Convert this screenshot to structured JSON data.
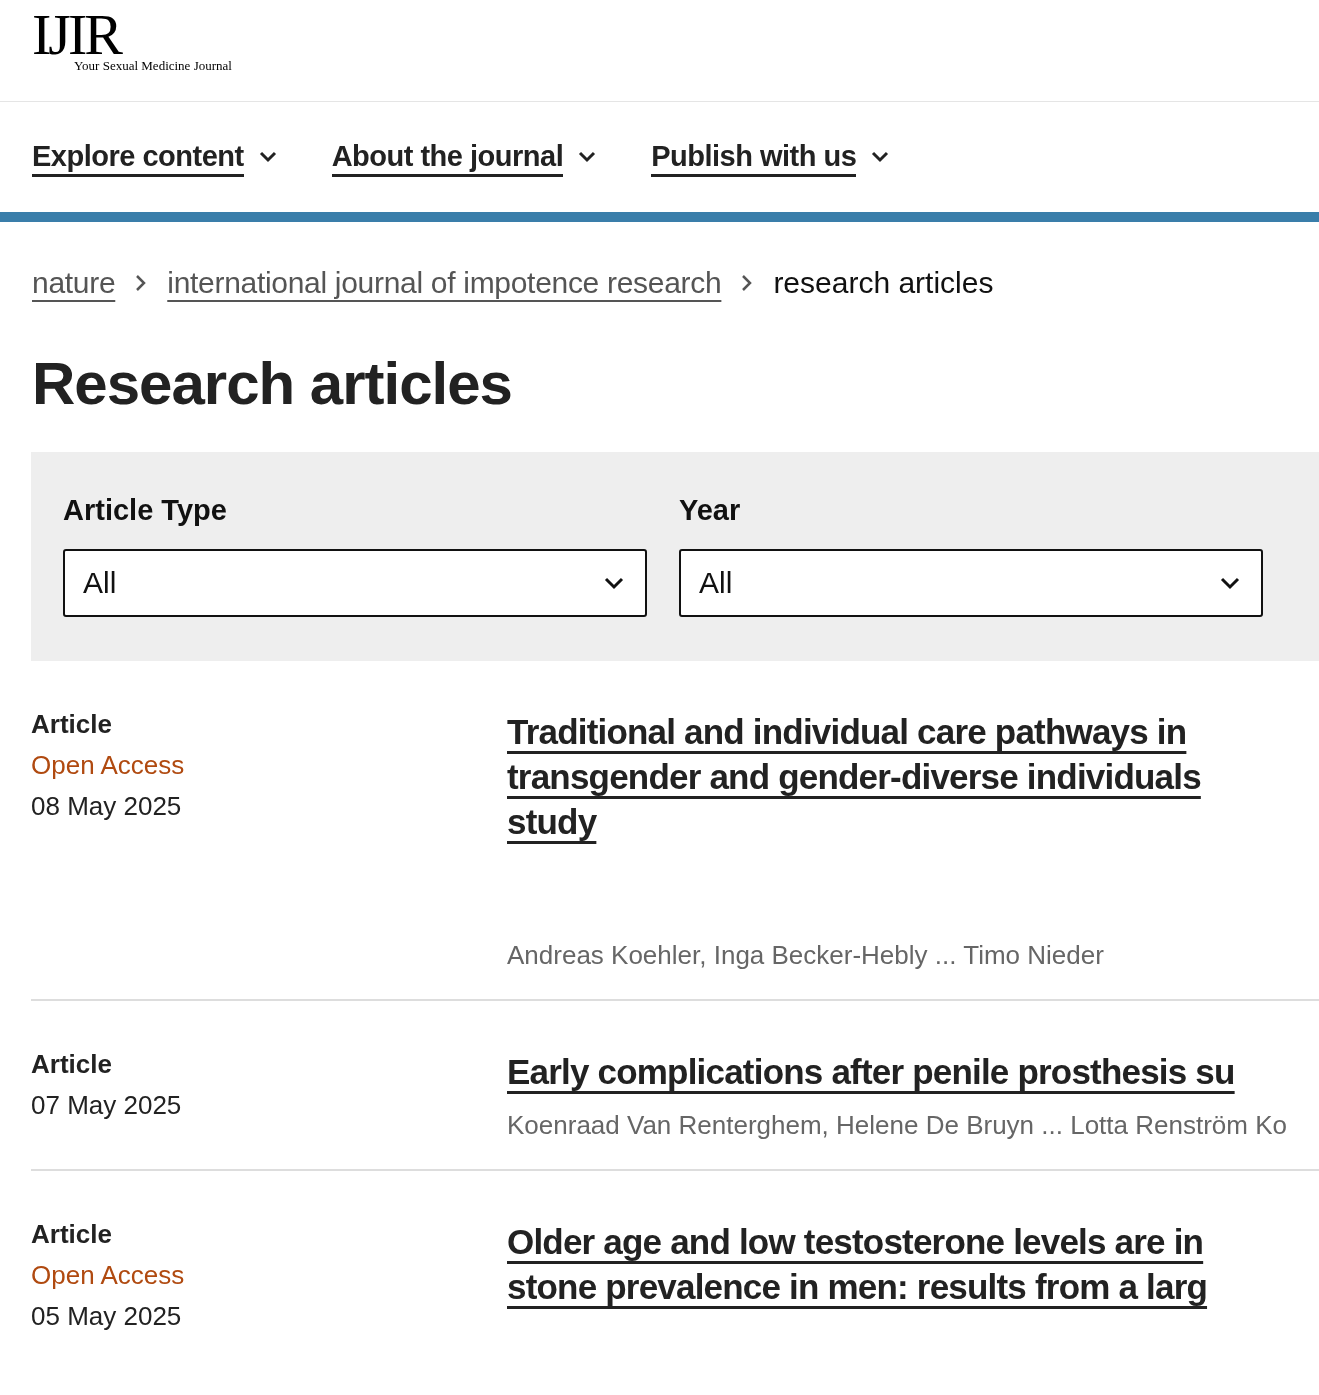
{
  "logo": {
    "mark": "IJIR",
    "tagline": "Your Sexual Medicine Journal"
  },
  "nav": [
    {
      "label": "Explore content"
    },
    {
      "label": "About the journal"
    },
    {
      "label": "Publish with us"
    }
  ],
  "breadcrumbs": [
    {
      "label": "nature",
      "kind": "link"
    },
    {
      "label": "international journal of impotence research",
      "kind": "link"
    },
    {
      "label": "research articles",
      "kind": "current"
    }
  ],
  "heading": "Research articles",
  "filters": [
    {
      "label": "Article Type",
      "value": "All"
    },
    {
      "label": "Year",
      "value": "All"
    }
  ],
  "articles": [
    {
      "type": "Article",
      "access": "Open Access",
      "date": "08 May 2025",
      "title_lines": [
        "Traditional and individual care pathways in",
        "transgender and gender-diverse individuals",
        "study"
      ],
      "authors": "Andreas Koehler, Inga Becker-Hebly ... Timo Nieder"
    },
    {
      "type": "Article",
      "date": "07 May 2025",
      "title_lines": [
        "Early complications after penile prosthesis su"
      ],
      "authors": "Koenraad Van Renterghem, Helene De Bruyn ... Lotta Renström Ko"
    },
    {
      "type": "Article",
      "access": "Open Access",
      "date": "05 May 2025",
      "title_lines": [
        "Older age and low testosterone levels are in",
        "stone prevalence in men: results from a larg"
      ]
    }
  ]
}
